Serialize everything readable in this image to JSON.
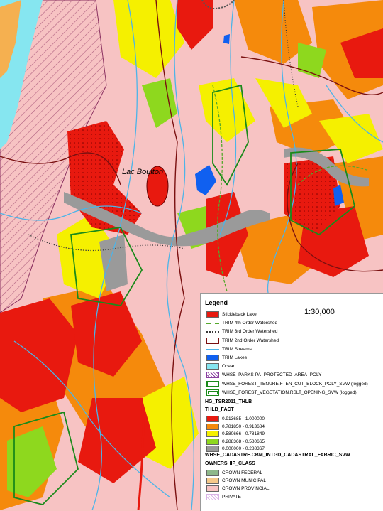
{
  "map": {
    "place_label": "Lac Boulton",
    "colors": {
      "background": "#f7c3c3",
      "thlb_high": "#e8190f",
      "thlb_2": "#f58a0c",
      "thlb_3": "#f5f000",
      "thlb_4": "#8ed81e",
      "thlb_5": "#9a9a9a",
      "ocean": "#86e6f0",
      "lakes": "#1060f0",
      "streams": "#4cb4e8",
      "watershed_2nd": "#7a1010",
      "watershed_3rd": "#3a3a3a",
      "watershed_4th": "#55a82c",
      "cutblock": "#1a8a1a"
    }
  },
  "legend": {
    "title": "Legend",
    "scale": "1:30,000",
    "items": [
      {
        "label": "Stickleback Lake",
        "icon": "red-fill-swatch",
        "color": "#e8190f"
      },
      {
        "label": "TRIM 4th Order Watershed",
        "icon": "green-dashed-line-swatch",
        "color": "#55a82c"
      },
      {
        "label": "TRIM 3rd Order Watershed",
        "icon": "dotted-line-swatch",
        "color": "#3a3a3a"
      },
      {
        "label": "TRIM 2nd Order Watershed",
        "icon": "dark-red-outline-swatch",
        "color": "#7a1010"
      },
      {
        "label": "TRIM Streams",
        "icon": "blue-line-swatch",
        "color": "#4cb4e8"
      },
      {
        "label": "TRIM Lakes",
        "icon": "blue-fill-swatch",
        "color": "#1060f0"
      },
      {
        "label": "Ocean",
        "icon": "cyan-fill-swatch",
        "color": "#86e6f0"
      },
      {
        "label": "WHSE_PARKS-PA_PROTECTED_AREA_POLY",
        "icon": "purple-hatch-swatch",
        "color": "#8a3fa0"
      },
      {
        "label": "WHSE_FOREST_TENURE.FTEN_CUT_BLOCK_POLY_SVW (logged)",
        "icon": "green-outline-swatch",
        "color": "#1a8a1a"
      },
      {
        "label": "WHSE_FOREST_VEGETATION.RSLT_OPENING_SVW (logged)",
        "icon": "green-double-outline-swatch",
        "color": "#1a8a1a"
      }
    ],
    "thlb_layer": "HG_TSR2011_THLB",
    "thlb_field": "THLB_FACT",
    "thlb_classes": [
      {
        "label": "0.913685 - 1.000000",
        "color": "#e8190f"
      },
      {
        "label": "0.781850 - 0.913684",
        "color": "#f58a0c"
      },
      {
        "label": "0.580666 - 0.781849",
        "color": "#f5f000"
      },
      {
        "label": "0.288368 - 0.580665",
        "color": "#8ed81e"
      },
      {
        "label": "0.000000 - 0.288367",
        "color": "#9a9a9a"
      }
    ],
    "cadastre_layer": "WHSE_CADASTRE.CBM_INTGD_CADASTRAL_FABRIC_SVW",
    "ownership_field": "OWNERSHIP_CLASS",
    "ownership_classes": [
      {
        "label": "CROWN FEDERAL",
        "color": "#8fb88a"
      },
      {
        "label": "CROWN MUNICIPAL",
        "color": "#f5c98a"
      },
      {
        "label": "CROWN PROVINCIAL",
        "color": "#f7c3c3"
      },
      {
        "label": "PRIVATE",
        "icon": "purple-hatch-swatch",
        "color": "#d9b3e6"
      }
    ]
  }
}
